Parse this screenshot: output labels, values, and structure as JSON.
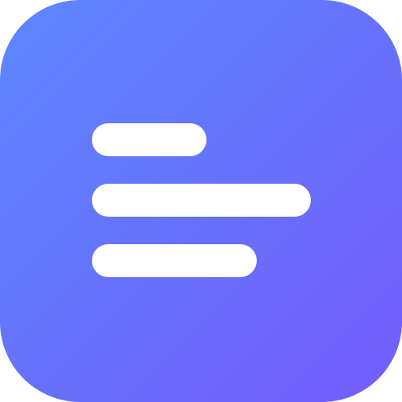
{
  "icon": {
    "name": "text-lines-app-icon",
    "glyph": "align-left-lines-icon",
    "gradient": {
      "start": "#5c87ff",
      "middle": "#6672fb",
      "end": "#755cfc"
    },
    "line_color": "#ffffff",
    "lines": [
      {
        "id": "top"
      },
      {
        "id": "middle"
      },
      {
        "id": "bottom"
      }
    ]
  }
}
